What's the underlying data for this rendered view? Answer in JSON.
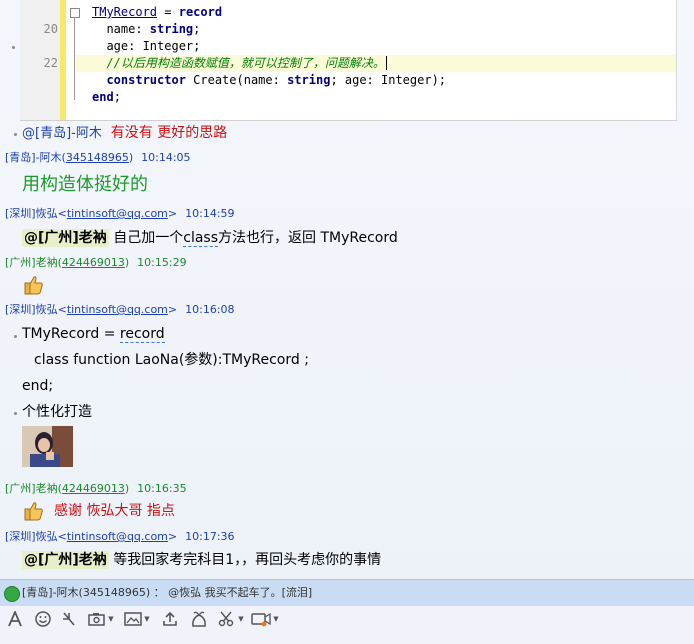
{
  "code_image": {
    "line_numbers": [
      "20",
      "22"
    ],
    "lines": [
      {
        "ident": "TMyRecord",
        "op": " = ",
        "kw": "record"
      },
      {
        "name_part": "  name: ",
        "type": "string",
        "end": ";"
      },
      {
        "text": "  age: Integer;"
      },
      {
        "comment": "  //以后用构造函数赋值，就可以控制了，问题解决。"
      },
      {
        "kw": "  constructor",
        "rest1": " Create(name: ",
        "type": "string",
        "rest2": "; age: Integer);"
      },
      {
        "kw": "end",
        "end": ";"
      }
    ]
  },
  "messages": {
    "m0": {
      "sender": "@[青岛]-阿木",
      "text": "有没有  更好的思路"
    },
    "m1": {
      "sender": "[青岛]-阿木(",
      "id": "345148965",
      "close": ")",
      "time": "10:14:05",
      "text": "用构造体挺好的"
    },
    "m2": {
      "sender": "[深圳]恢弘<",
      "email": "tintinsoft@qq.com",
      "close": ">",
      "time": "10:14:59",
      "mention": "@[广州]老衲",
      "text_a": " 自己加一个",
      "squiggle": "class",
      "text_b": "方法也行，返回 TMyRecord"
    },
    "m3": {
      "sender": "[广州]老衲(",
      "id": "424469013",
      "close": ")",
      "time": "10:15:29"
    },
    "m4": {
      "sender": "[深圳]恢弘<",
      "email": "tintinsoft@qq.com",
      "close": ">",
      "time": "10:16:08",
      "line1_a": "TMyRecord = ",
      "line1_b": "record",
      "line2": "class function LaoNa(参数):TMyRecord ;",
      "line3": "end;",
      "line4": "个性化打造"
    },
    "m5": {
      "sender": "[广州]老衲(",
      "id": "424469013",
      "close": ")",
      "time": "10:16:35",
      "text": "感谢  恢弘大哥  指点"
    },
    "m6": {
      "sender": "[深圳]恢弘<",
      "email": "tintinsoft@qq.com",
      "close": ">",
      "time": "10:17:36",
      "mention": "@[广州]老衲",
      "text": " 等我回家考完科目1，，再回头考虑你的事情"
    }
  },
  "status_bar": {
    "text": "[青岛]-阿木(345148965) ： @恢弘 我买不起车了。[流泪]"
  },
  "toolbar": {
    "icons": [
      "font-icon",
      "emoji-icon",
      "shake-icon",
      "screenshot-icon",
      "image-icon",
      "upload-icon",
      "gift-icon",
      "scissors-icon",
      "record-icon"
    ]
  },
  "colors": {
    "sender_blue": "#1e40b4",
    "sender_green": "#1a8a2a",
    "highlight_red": "#d01010",
    "large_green": "#1d9a2c"
  }
}
